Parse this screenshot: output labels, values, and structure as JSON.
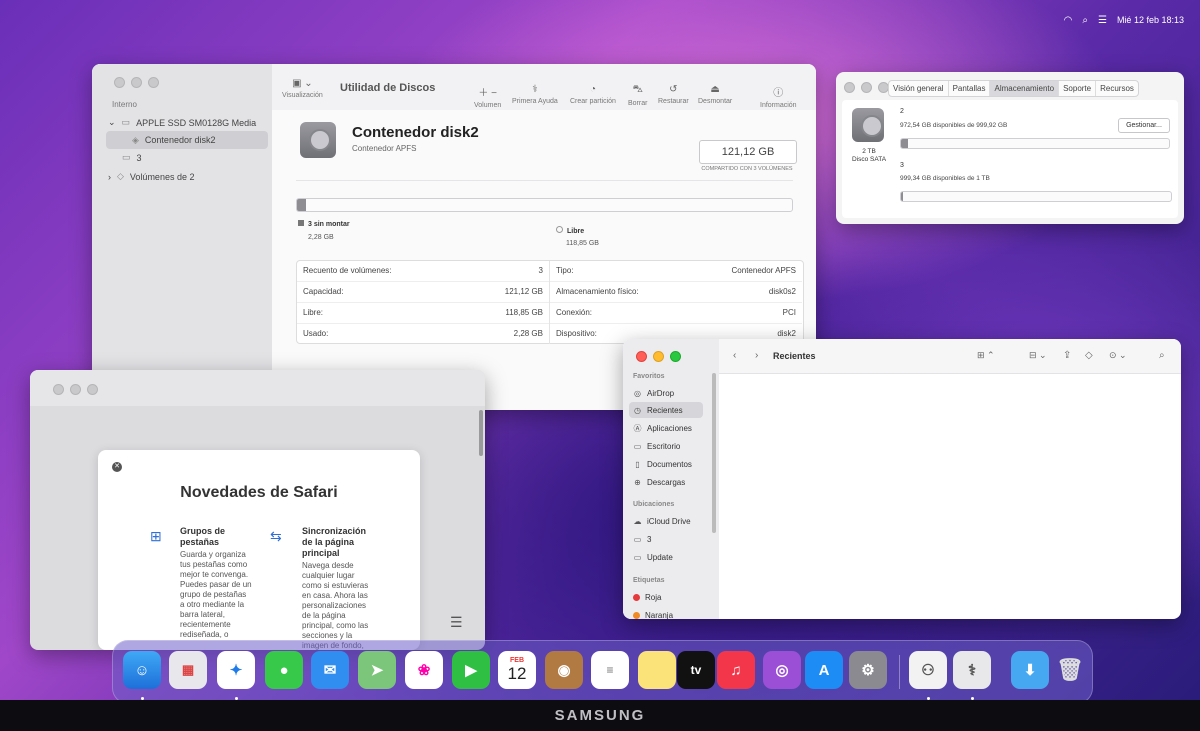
{
  "menubar": {
    "datetime": "Mié 12 feb  18:13"
  },
  "disk_utility": {
    "sidebar": {
      "section": "Interno",
      "items": [
        {
          "label": "APPLE SSD SM0128G Media"
        },
        {
          "label": "Contenedor disk2"
        },
        {
          "label": "3"
        },
        {
          "label": "Volúmenes de 2"
        }
      ]
    },
    "toolbar": {
      "view_label": "Visualización",
      "title": "Utilidad de Discos",
      "volume_label": "Volumen",
      "first_aid_label": "Primera Ayuda",
      "partition_label": "Crear partición",
      "erase_label": "Borrar",
      "restore_label": "Restaurar",
      "unmount_label": "Desmontar",
      "info_label": "Información"
    },
    "header": {
      "title": "Contenedor disk2",
      "subtitle": "Contenedor APFS",
      "size": "121,12 GB",
      "size_caption": "COMPARTIDO CON 3 VOLÚMENES"
    },
    "usage_fraction": 0.019,
    "legend": [
      {
        "label": "3 sin montar",
        "value": "2,28 GB"
      },
      {
        "label": "Libre",
        "value": "118,85 GB"
      }
    ],
    "info_left": [
      {
        "key": "Recuento de volúmenes:",
        "value": "3"
      },
      {
        "key": "Capacidad:",
        "value": "121,12 GB"
      },
      {
        "key": "Libre:",
        "value": "118,85 GB"
      },
      {
        "key": "Usado:",
        "value": "2,28 GB"
      }
    ],
    "info_right": [
      {
        "key": "Tipo:",
        "value": "Contenedor APFS"
      },
      {
        "key": "Almacenamiento físico:",
        "value": "disk0s2"
      },
      {
        "key": "Conexión:",
        "value": "PCI"
      },
      {
        "key": "Dispositivo:",
        "value": "disk2"
      }
    ]
  },
  "system_info": {
    "tabs": [
      "Visión general",
      "Pantallas",
      "Almacenamiento",
      "Soporte",
      "Recursos"
    ],
    "active_tab": "Almacenamiento",
    "disk_label": "2 TB\nDisco SATA",
    "volumes": [
      {
        "name": "2",
        "detail": "972,54 GB disponibles de 999,92 GB",
        "used_fraction": 0.027
      },
      {
        "name": "3",
        "detail": "999,34 GB disponibles de 1 TB",
        "used_fraction": 0.001
      }
    ],
    "manage_button": "Gestionar..."
  },
  "finder": {
    "title": "Recientes",
    "sections": [
      {
        "title": "Favoritos",
        "items": [
          {
            "label": "AirDrop",
            "icon": "airdrop-icon"
          },
          {
            "label": "Recientes",
            "icon": "clock-icon"
          },
          {
            "label": "Aplicaciones",
            "icon": "applications-icon"
          },
          {
            "label": "Escritorio",
            "icon": "desktop-icon"
          },
          {
            "label": "Documentos",
            "icon": "document-icon"
          },
          {
            "label": "Descargas",
            "icon": "download-icon"
          }
        ]
      },
      {
        "title": "Ubicaciones",
        "items": [
          {
            "label": "iCloud Drive",
            "icon": "cloud-icon"
          },
          {
            "label": "3",
            "icon": "drive-icon"
          },
          {
            "label": "Update",
            "icon": "drive-icon"
          }
        ]
      },
      {
        "title": "Etiquetas",
        "items": [
          {
            "label": "Roja",
            "color": "#e5393b"
          },
          {
            "label": "Naranja",
            "color": "#f08a24"
          }
        ]
      }
    ]
  },
  "safari": {
    "card_title": "Novedades de Safari",
    "features": [
      {
        "title": "Grupos de pestañas",
        "body": "Guarda y organiza tus pestañas como mejor te convenga. Puedes pasar de un grupo de pestañas a otro mediante la barra lateral, recientemente rediseñada, o"
      },
      {
        "title": "Sincronización de la página principal",
        "body": "Navega desde cualquier lugar como si estuvieras en casa. Ahora las personalizaciones de la página principal, como las secciones y la imagen de fondo,"
      }
    ]
  },
  "dock": {
    "calendar_month": "FEB",
    "calendar_day": "12",
    "tv_label": "tv"
  },
  "monitor": {
    "brand": "SAMSUNG"
  }
}
